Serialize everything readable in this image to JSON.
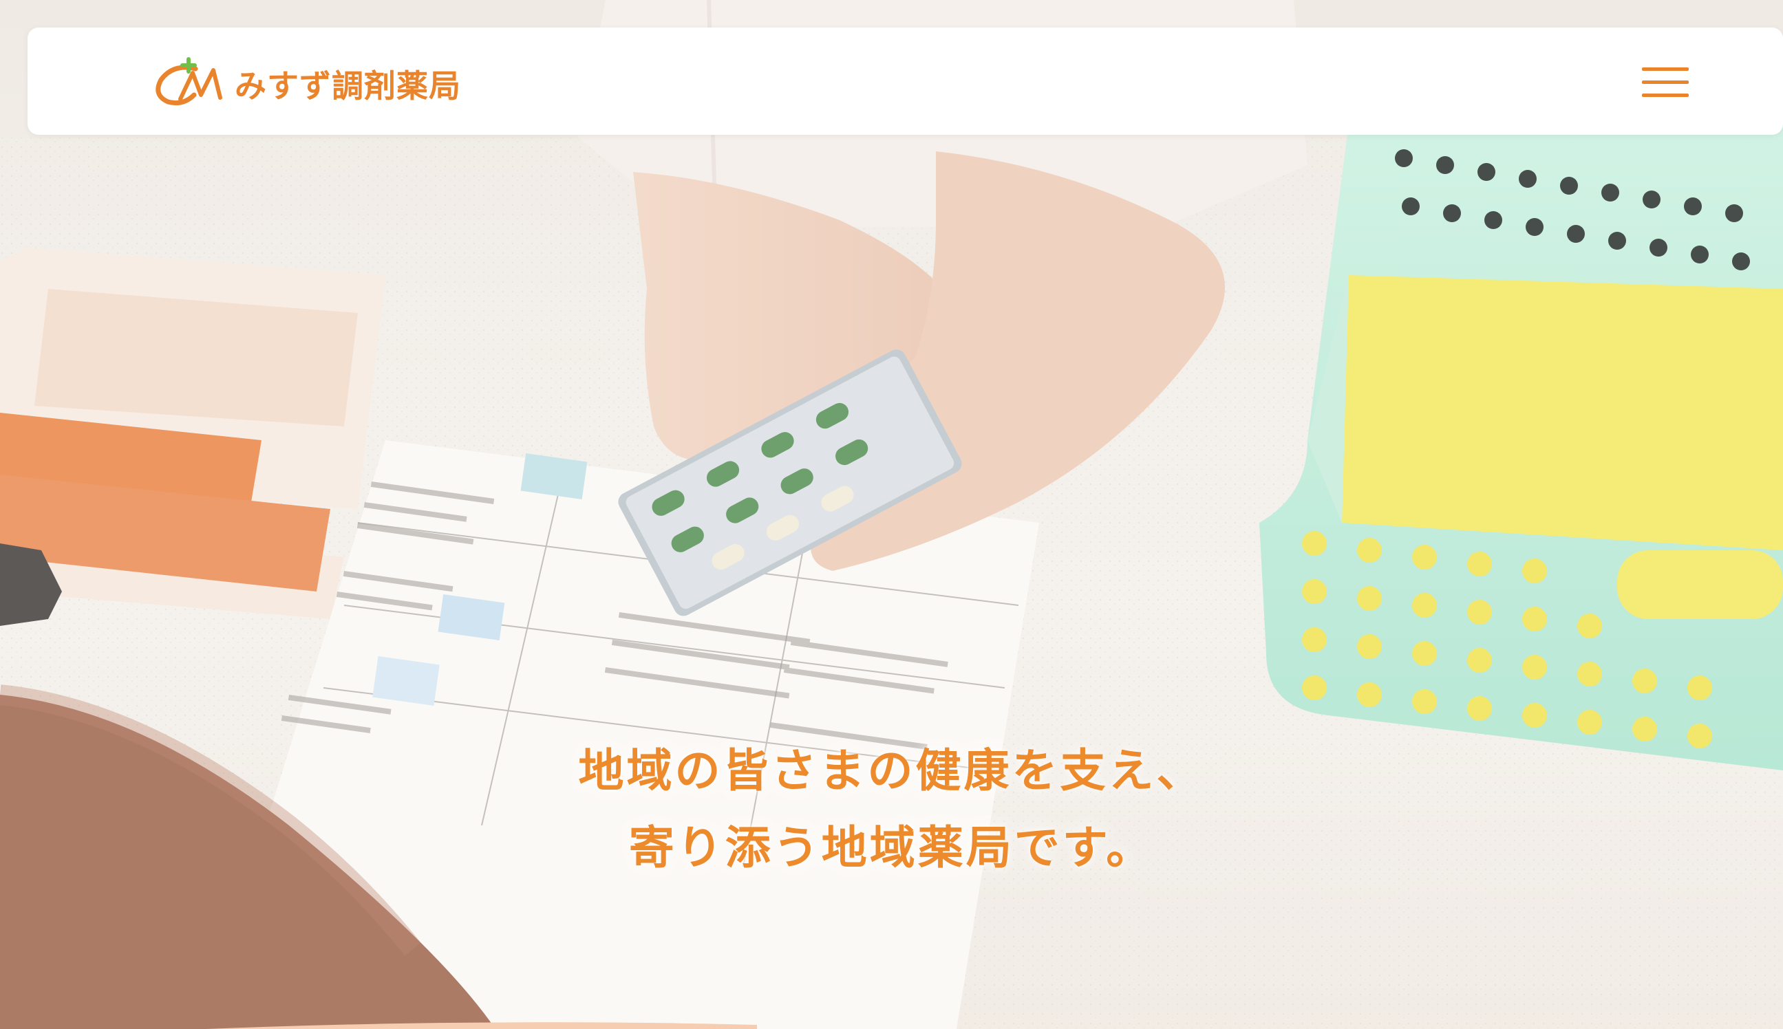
{
  "header": {
    "logo_text": "みすず調剤薬局",
    "logo_icon": "misuzu-logo-mark",
    "menu_icon": "hamburger-menu-icon"
  },
  "hero": {
    "catch_line_1": "地域の皆さまの健康を支え、",
    "catch_line_2": "寄り添う地域薬局です。"
  },
  "colors": {
    "brand_orange": "#e9842c",
    "header_bg": "#ffffff",
    "basket_mint": "#b6ead6",
    "basket_yellow": "#f4e85a"
  }
}
